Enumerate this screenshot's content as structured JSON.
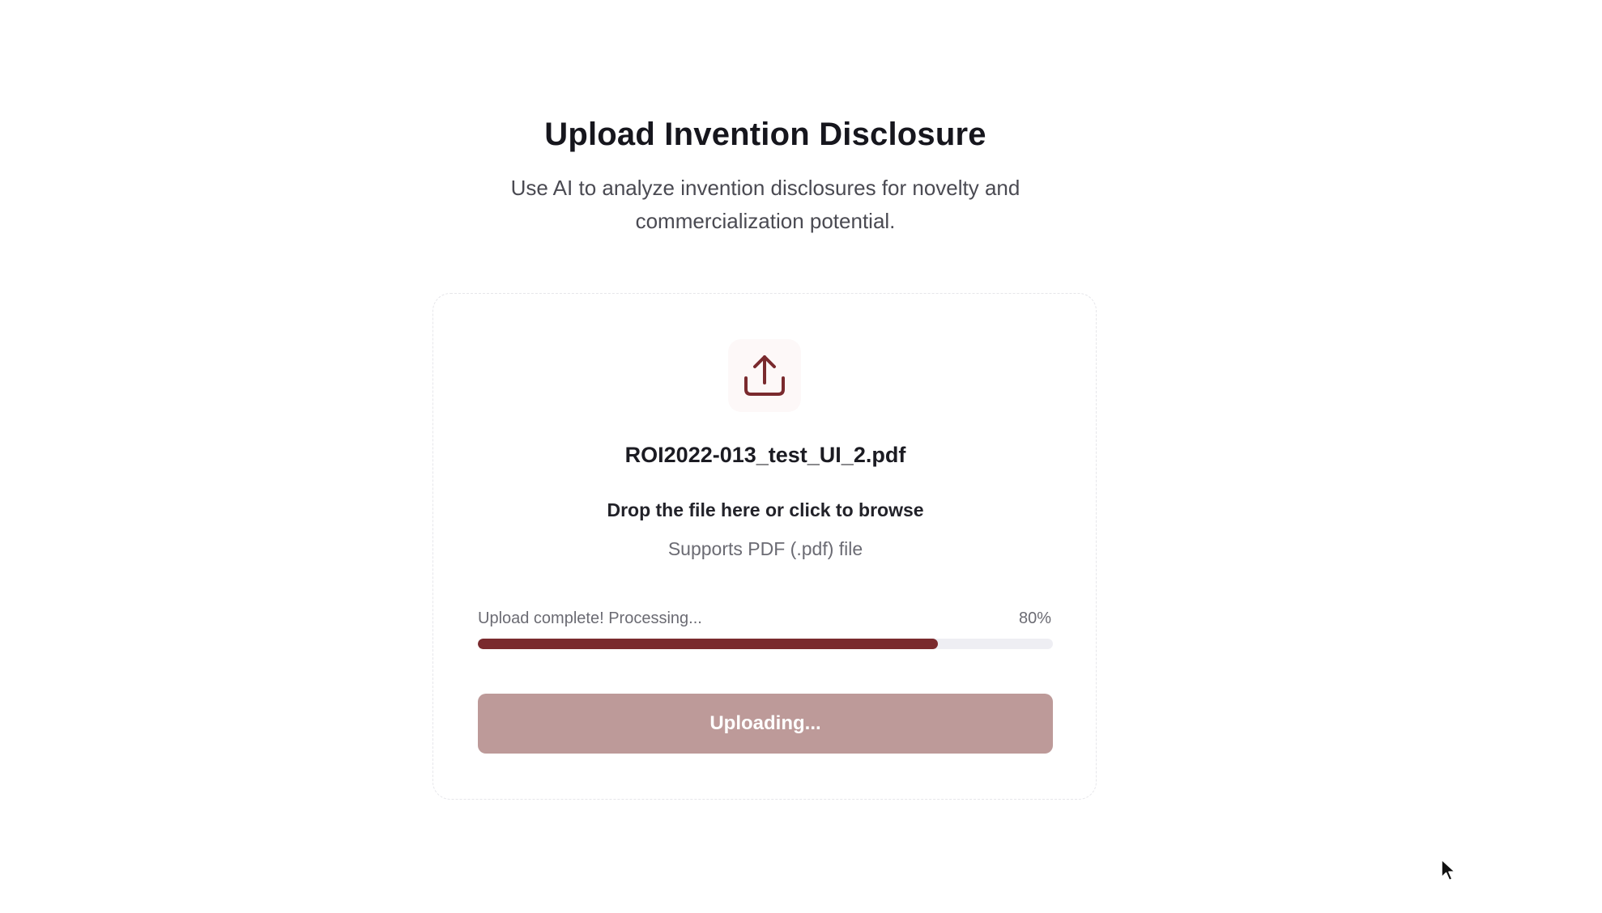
{
  "header": {
    "title": "Upload Invention Disclosure",
    "subtitle": "Use AI to analyze invention disclosures for novelty and commercialization potential."
  },
  "upload": {
    "icon": "upload-icon",
    "filename": "ROI2022-013_test_UI_2.pdf",
    "drop_text": "Drop the file here or click to browse",
    "support_text": "Supports PDF (.pdf) file",
    "progress": {
      "label": "Upload complete! Processing...",
      "percent_text": "80%",
      "value": 0.8
    },
    "button_label": "Uploading..."
  },
  "colors": {
    "accent": "#7a2a2e",
    "button_disabled": "#bd9a99",
    "track": "#eeeef3"
  }
}
